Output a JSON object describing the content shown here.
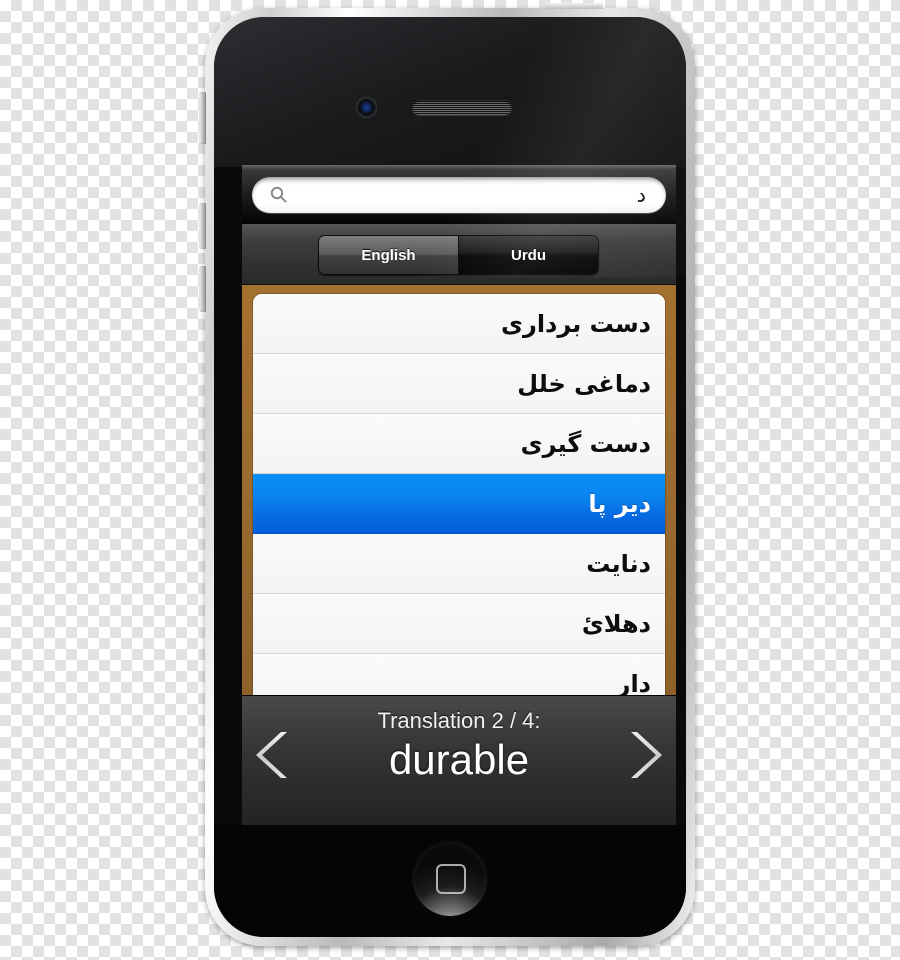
{
  "device": {
    "name": "iPhone 4",
    "home_button_icon": "rounded-square-icon",
    "camera_icon": "front-camera-icon",
    "speaker_icon": "earpiece-speaker-icon"
  },
  "search": {
    "icon": "search-icon",
    "value": "د",
    "placeholder": ""
  },
  "language_toggle": {
    "options": [
      {
        "label": "English",
        "selected": true
      },
      {
        "label": "Urdu",
        "selected": false
      }
    ]
  },
  "word_list": {
    "frame_color": "#9a6a2f",
    "selected_color": "#0a83ef",
    "items": [
      {
        "text": "دست برداری",
        "selected": false
      },
      {
        "text": "دماغی خلل",
        "selected": false
      },
      {
        "text": "دست گیری",
        "selected": false
      },
      {
        "text": "دیر پا",
        "selected": true
      },
      {
        "text": "دنایت",
        "selected": false
      },
      {
        "text": "دهلائ",
        "selected": false
      },
      {
        "text": "دار",
        "selected": false
      }
    ]
  },
  "translation": {
    "label": "Translation 2 / 4:",
    "word": "durable",
    "index": 2,
    "total": 4,
    "prev_icon": "chevron-left-icon",
    "next_icon": "chevron-right-icon"
  }
}
